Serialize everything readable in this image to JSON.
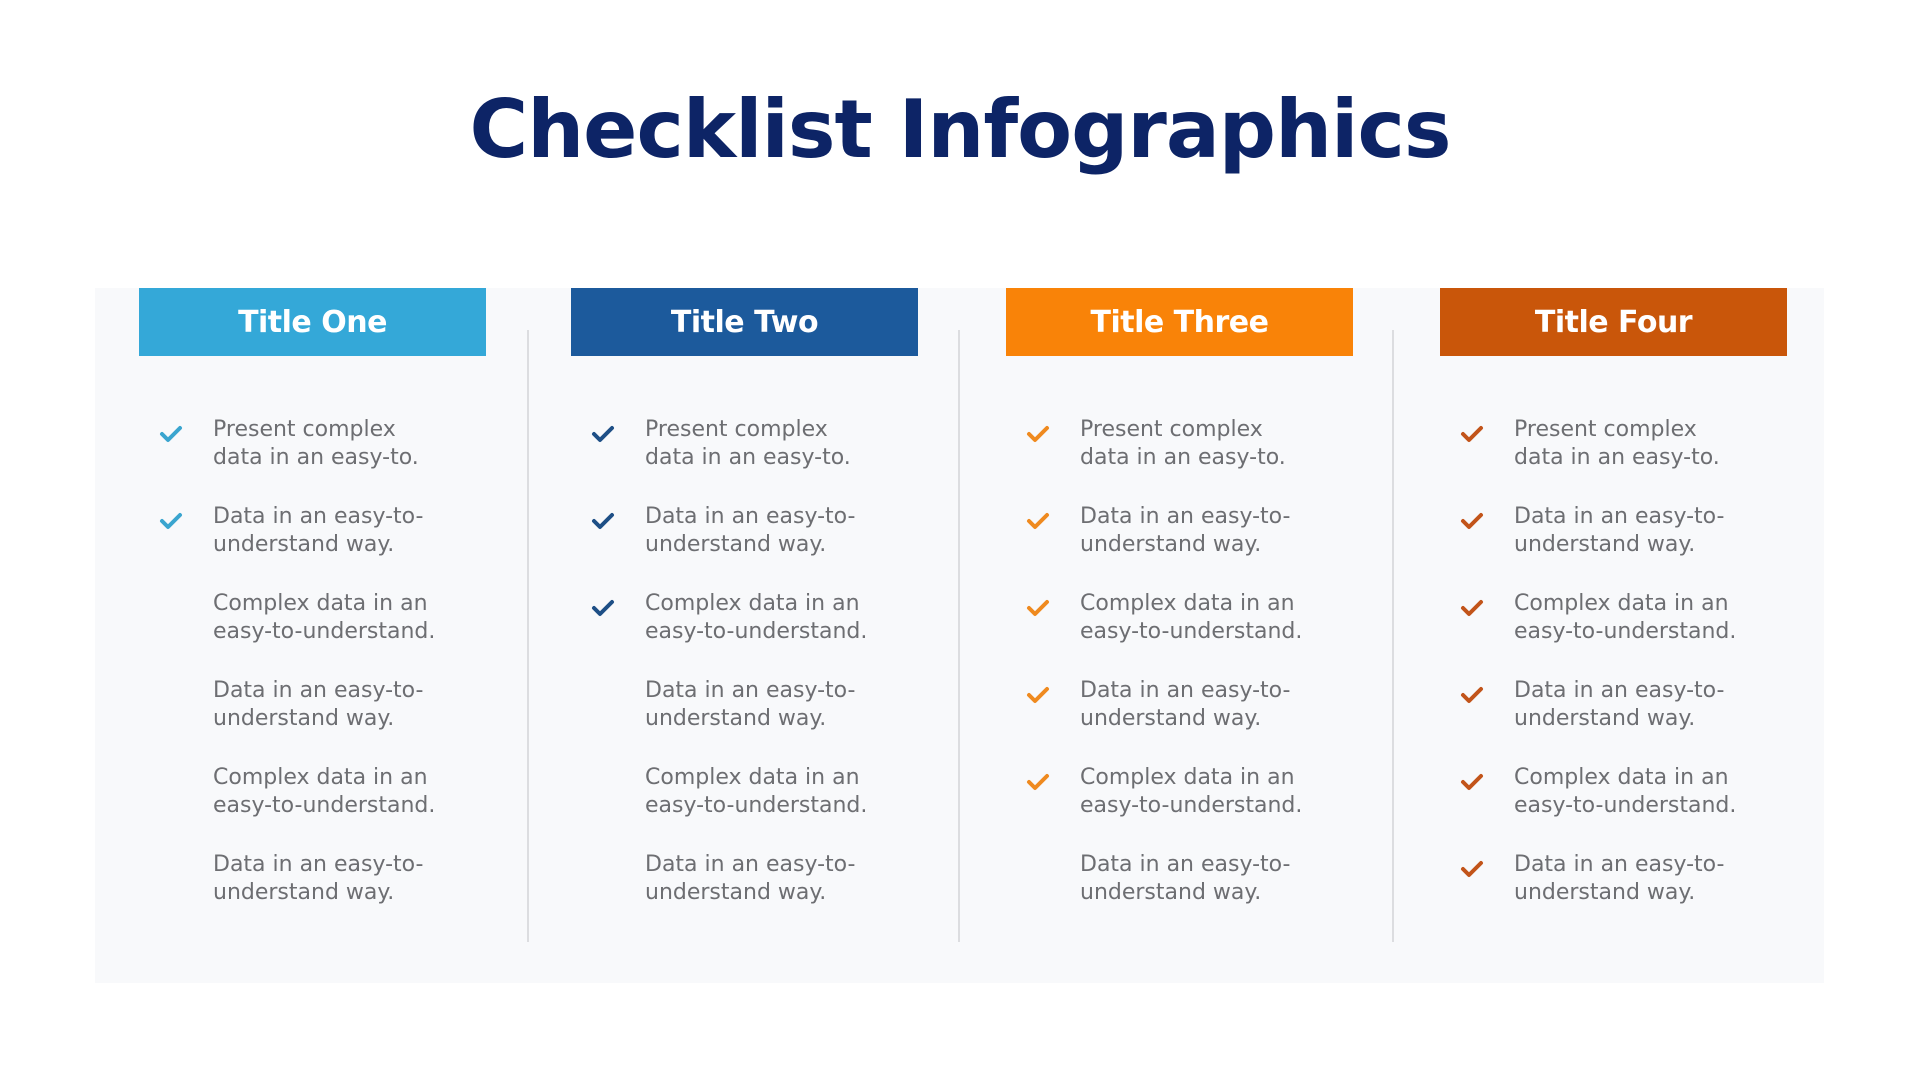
{
  "title": "Checklist Infographics",
  "columns": [
    {
      "title": "Title One",
      "header_color": "#34a8d8",
      "check_color": "#3aa5cf",
      "items": [
        {
          "line1": "Present complex",
          "line2": "data in an easy-to.",
          "checked": true
        },
        {
          "line1": "Data in an easy-to-",
          "line2": "understand way.",
          "checked": true
        },
        {
          "line1": "Complex data in an",
          "line2": "easy-to-understand.",
          "checked": false
        },
        {
          "line1": "Data in an easy-to-",
          "line2": "understand way.",
          "checked": false
        },
        {
          "line1": "Complex data in an",
          "line2": "easy-to-understand.",
          "checked": false
        },
        {
          "line1": "Data in an easy-to-",
          "line2": "understand way.",
          "checked": false
        }
      ]
    },
    {
      "title": "Title Two",
      "header_color": "#1c5a9c",
      "check_color": "#1e4f86",
      "items": [
        {
          "line1": "Present complex",
          "line2": "data in an easy-to.",
          "checked": true
        },
        {
          "line1": "Data in an easy-to-",
          "line2": "understand way.",
          "checked": true
        },
        {
          "line1": "Complex data in an",
          "line2": "easy-to-understand.",
          "checked": true
        },
        {
          "line1": "Data in an easy-to-",
          "line2": "understand way.",
          "checked": false
        },
        {
          "line1": "Complex data in an",
          "line2": "easy-to-understand.",
          "checked": false
        },
        {
          "line1": "Data in an easy-to-",
          "line2": "understand way.",
          "checked": false
        }
      ]
    },
    {
      "title": "Title Three",
      "header_color": "#f98308",
      "check_color": "#ef8a1f",
      "items": [
        {
          "line1": "Present complex",
          "line2": "data in an easy-to.",
          "checked": true
        },
        {
          "line1": "Data in an easy-to-",
          "line2": "understand way.",
          "checked": true
        },
        {
          "line1": "Complex data in an",
          "line2": "easy-to-understand.",
          "checked": true
        },
        {
          "line1": "Data in an easy-to-",
          "line2": "understand way.",
          "checked": true
        },
        {
          "line1": "Complex data in an",
          "line2": "easy-to-understand.",
          "checked": true
        },
        {
          "line1": "Data in an easy-to-",
          "line2": "understand way.",
          "checked": false
        }
      ]
    },
    {
      "title": "Title Four",
      "header_color": "#c9560a",
      "check_color": "#c2541a",
      "items": [
        {
          "line1": "Present complex",
          "line2": "data in an easy-to.",
          "checked": true
        },
        {
          "line1": "Data in an easy-to-",
          "line2": "understand way.",
          "checked": true
        },
        {
          "line1": "Complex data in an",
          "line2": "easy-to-understand.",
          "checked": true
        },
        {
          "line1": "Data in an easy-to-",
          "line2": "understand way.",
          "checked": true
        },
        {
          "line1": "Complex data in an",
          "line2": "easy-to-understand.",
          "checked": true
        },
        {
          "line1": "Data in an easy-to-",
          "line2": "understand way.",
          "checked": true
        }
      ]
    }
  ]
}
